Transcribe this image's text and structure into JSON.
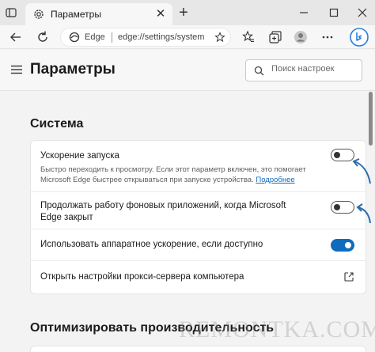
{
  "browser": {
    "tab_title": "Параметры",
    "address_site": "Edge",
    "address_url": "edge://settings/system"
  },
  "settings": {
    "page_title": "Параметры",
    "search_placeholder": "Поиск настроек"
  },
  "system_section": {
    "title": "Система",
    "rows": [
      {
        "label": "Ускорение запуска",
        "description": "Быстро переходить к просмотру. Если этот параметр включен, это помогает Microsoft Edge быстрее открываться при запуске устройства.",
        "link": "Подробнее",
        "toggle": "off"
      },
      {
        "label": "Продолжать работу фоновых приложений, когда Microsoft Edge закрыт",
        "toggle": "off"
      },
      {
        "label": "Использовать аппаратное ускорение, если доступно",
        "toggle": "on"
      },
      {
        "label": "Открыть настройки прокси-сервера компьютера",
        "action_icon": "external-link-icon"
      }
    ]
  },
  "performance_section": {
    "title": "Оптимизировать производительность"
  },
  "watermark": "REMONTKA.COM",
  "colors": {
    "accent": "#0f6cbd",
    "arrow": "#2b6cb0"
  }
}
